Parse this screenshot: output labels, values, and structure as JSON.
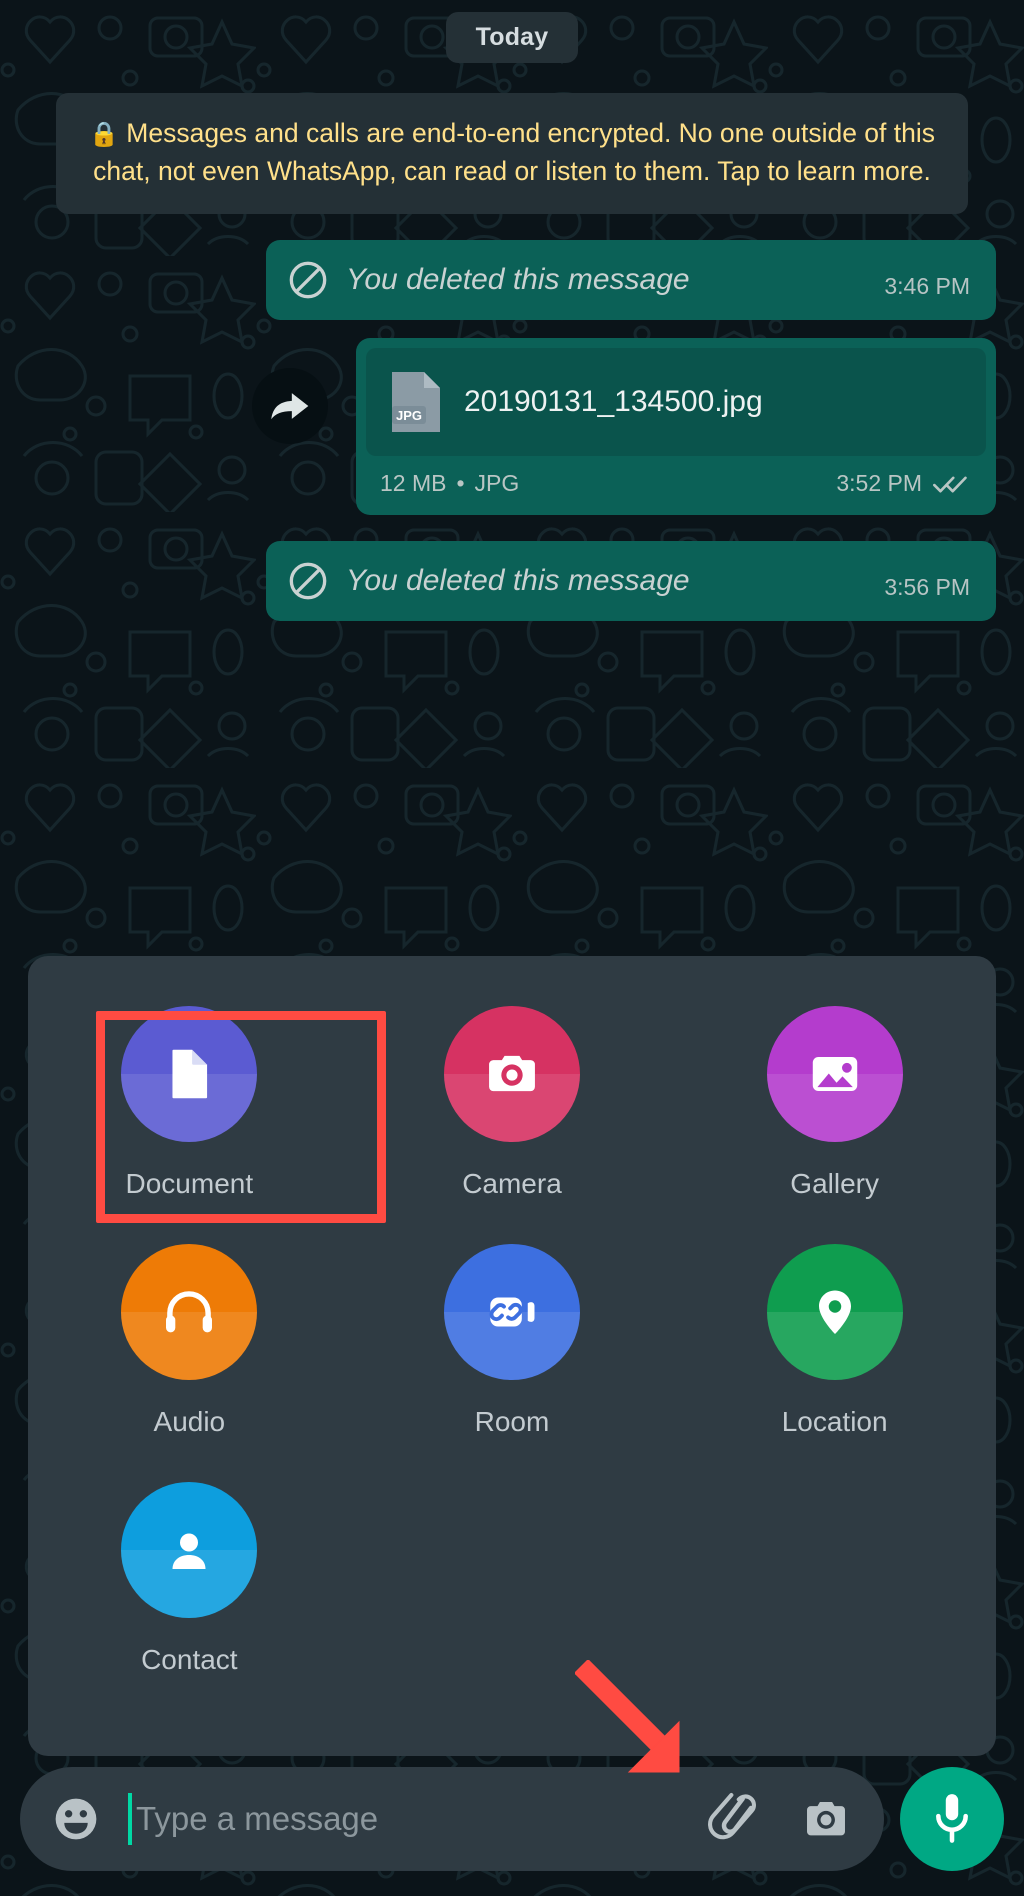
{
  "chat": {
    "day_divider": "Today",
    "encryption_notice": {
      "lock_icon": "lock-icon",
      "text": "Messages and calls are end-to-end encrypted. No one outside of this chat, not even WhatsApp, can read or listen to them. Tap to learn more."
    },
    "messages": [
      {
        "type": "deleted",
        "icon": "block-icon",
        "text": "You deleted this message",
        "time": "3:46 PM"
      },
      {
        "type": "document",
        "forwarded_icon": "forward-arrow-icon",
        "file_icon": "jpg-file-icon",
        "file_icon_label": "JPG",
        "filename": "20190131_134500.jpg",
        "size": "12 MB",
        "separator": "•",
        "filetype": "JPG",
        "time": "3:52 PM",
        "status_icon": "double-check-icon"
      },
      {
        "type": "deleted",
        "icon": "block-icon",
        "text": "You deleted this message",
        "time": "3:56 PM"
      }
    ]
  },
  "attachment_panel": {
    "highlighted_item": "Document",
    "items": [
      {
        "label": "Document",
        "icon": "document-icon",
        "color": "#5b5bd2"
      },
      {
        "label": "Camera",
        "icon": "camera-icon",
        "color": "#d63262"
      },
      {
        "label": "Gallery",
        "icon": "gallery-icon",
        "color": "#b43ccd"
      },
      {
        "label": "Audio",
        "icon": "headphones-icon",
        "color": "#ee7b06"
      },
      {
        "label": "Room",
        "icon": "room-video-link-icon",
        "color": "#3d6fe0"
      },
      {
        "label": "Location",
        "icon": "location-pin-icon",
        "color": "#0f9d4f"
      },
      {
        "label": "Contact",
        "icon": "contact-person-icon",
        "color": "#0d9ede"
      }
    ]
  },
  "annotations": {
    "highlight_box_color": "#ff4b42",
    "arrow_color": "#ff4b42",
    "arrow_icon": "pointer-arrow-icon"
  },
  "input_bar": {
    "emoji_icon": "emoji-smiley-icon",
    "placeholder": "Type a message",
    "value": "",
    "attach_icon": "paperclip-icon",
    "camera_icon": "camera-icon",
    "mic_icon": "microphone-icon",
    "mic_button_color": "#00a884"
  }
}
